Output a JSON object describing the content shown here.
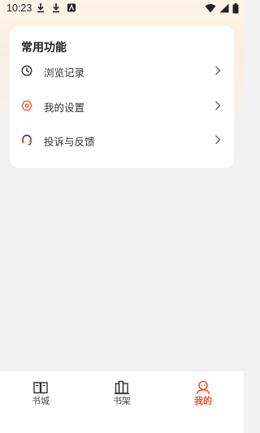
{
  "status_bar": {
    "time": "10:23"
  },
  "card": {
    "title": "常用功能",
    "items": [
      {
        "label": "浏览记录",
        "icon": "clock-icon"
      },
      {
        "label": "我的设置",
        "icon": "settings-hex-icon"
      },
      {
        "label": "投诉与反馈",
        "icon": "headset-icon"
      }
    ]
  },
  "bottom_nav": {
    "items": [
      {
        "label": "书城",
        "icon": "book-open-icon"
      },
      {
        "label": "书架",
        "icon": "bookshelf-icon"
      },
      {
        "label": "我的",
        "icon": "profile-icon",
        "active": true
      }
    ]
  },
  "colors": {
    "accent": "#e8572e",
    "icon_dark": "#333333"
  }
}
